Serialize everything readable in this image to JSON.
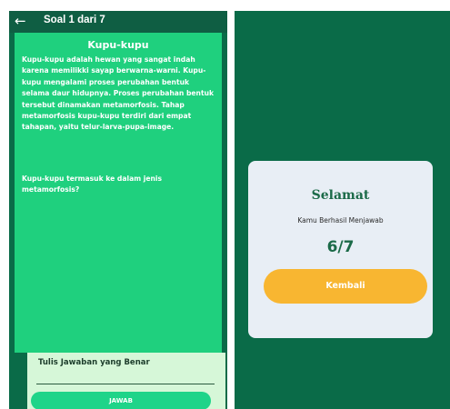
{
  "quiz": {
    "back_icon": "←",
    "title": "Soal 1 dari 7",
    "topic": "Kupu-kupu",
    "passage": "Kupu-kupu adalah hewan yang sangat indah karena memilikki sayap berwarna-warni. Kupu-kupu mengalami proses perubahan bentuk selama daur hidupnya. Proses perubahan bentuk tersebut dinamakan metamorfosis. Tahap metamorfosis kupu-kupu terdiri dari empat tahapan, yaitu telur-larva-pupa-image.",
    "question": "Kupu-kupu termasuk ke dalam jenis metamorfosis?",
    "answer_label": "Tulis Jawaban yang Benar",
    "answer_value": "",
    "submit_label": "JAWAB"
  },
  "result": {
    "title": "Selamat",
    "message": "Kamu Berhasil Menjawab",
    "score": "6/7",
    "back_label": "Kembali"
  },
  "colors": {
    "header": "#0f5e43",
    "background_dark": "#0a6b48",
    "content_green": "#1fd07e",
    "answer_card": "#d6f7d8",
    "submit_button": "#1ed489",
    "dialog_bg": "#e8eef5",
    "accent_orange": "#f8b631",
    "title_green": "#1b6a48"
  }
}
